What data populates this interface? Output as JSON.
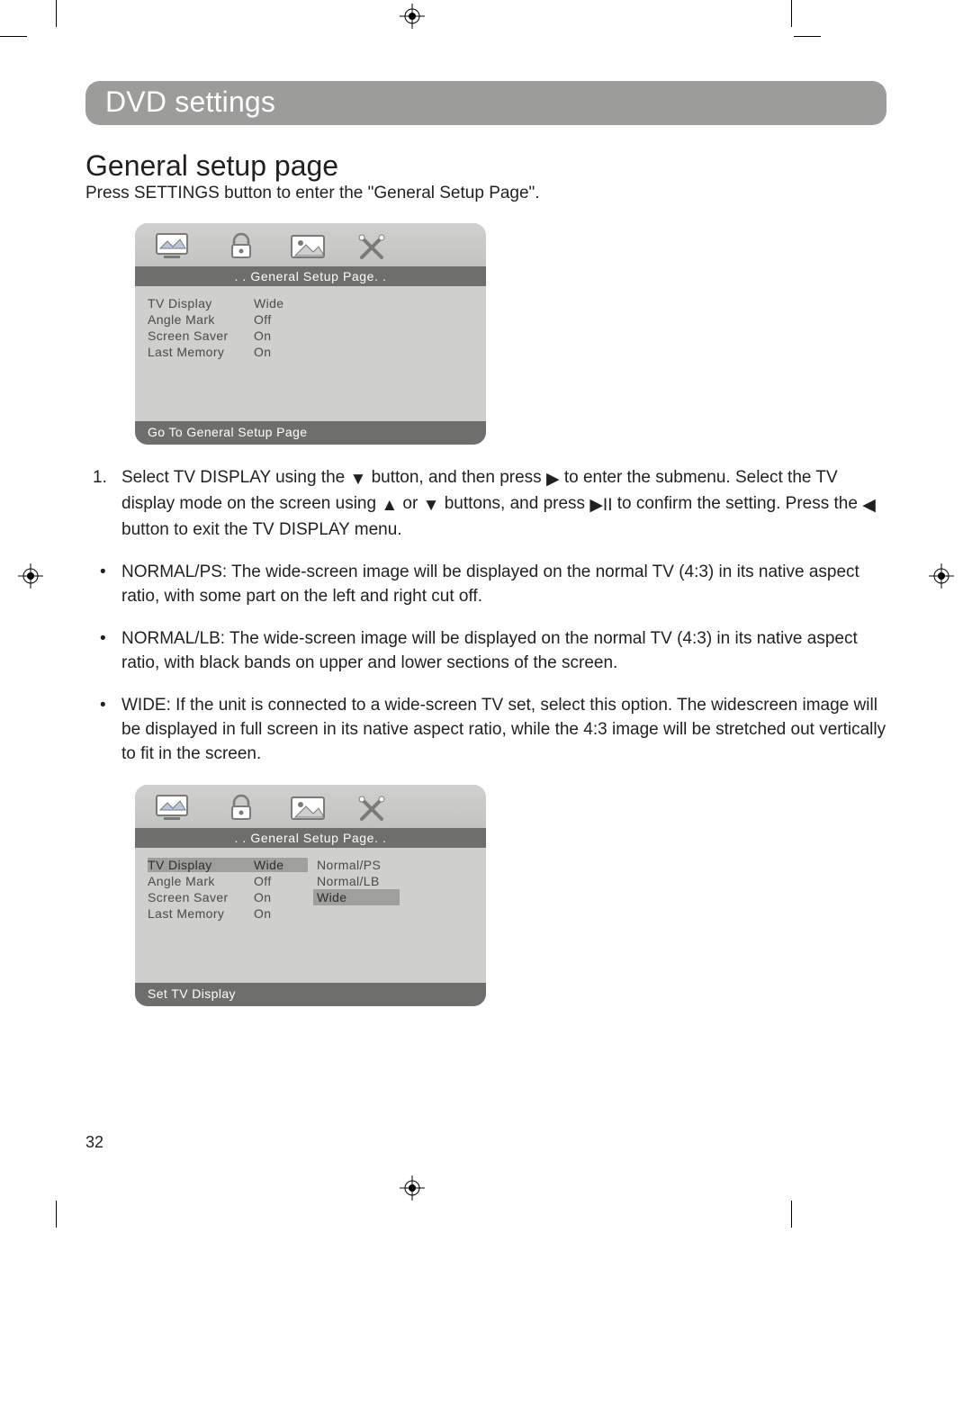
{
  "banner": "DVD settings",
  "subtitle": "General setup page",
  "intro": "Press SETTINGS button to enter the \"General Setup Page\".",
  "menu1": {
    "bar": ". . General  Setup  Page. .",
    "rows": [
      {
        "lbl": "TV  Display",
        "val": "Wide"
      },
      {
        "lbl": "Angle  Mark",
        "val": "Off"
      },
      {
        "lbl": "Screen  Saver",
        "val": "On"
      },
      {
        "lbl": "Last  Memory",
        "val": "On"
      }
    ],
    "footer": "Go  To  General  Setup  Page"
  },
  "step1": {
    "num": "1.",
    "a": "Select TV DISPLAY using the ",
    "b": " button, and then press ",
    "c": " to enter the submenu. Select the TV display mode on the screen using ",
    "d": " or ",
    "e": " buttons, and press ",
    "f": " to confirm the setting. Press the ",
    "g": " button to exit the TV DISPLAY menu."
  },
  "bullet_ps": "NORMAL/PS: The wide-screen image will be displayed on the normal TV (4:3) in its native aspect ratio, with some part on the left and right cut off.",
  "bullet_lb": "NORMAL/LB: The wide-screen image will be displayed on the normal TV (4:3) in its native aspect ratio, with black bands on upper and lower sections of the screen.",
  "bullet_wide": "WIDE: If the unit is connected to a wide-screen TV set, select this option. The widescreen image will be displayed in full screen in its native aspect ratio, while the 4:3 image will be stretched out vertically to fit in the screen.",
  "menu2": {
    "bar": ". . General  Setup  Page. .",
    "rows": [
      {
        "lbl": "TV  Display",
        "val": "Wide"
      },
      {
        "lbl": "Angle  Mark",
        "val": "Off"
      },
      {
        "lbl": "Screen  Saver",
        "val": "On"
      },
      {
        "lbl": "Last  Memory",
        "val": "On"
      }
    ],
    "opts": [
      "Normal/PS",
      "Normal/LB",
      "Wide"
    ],
    "footer": "Set  TV Display"
  },
  "pagenum": "32"
}
